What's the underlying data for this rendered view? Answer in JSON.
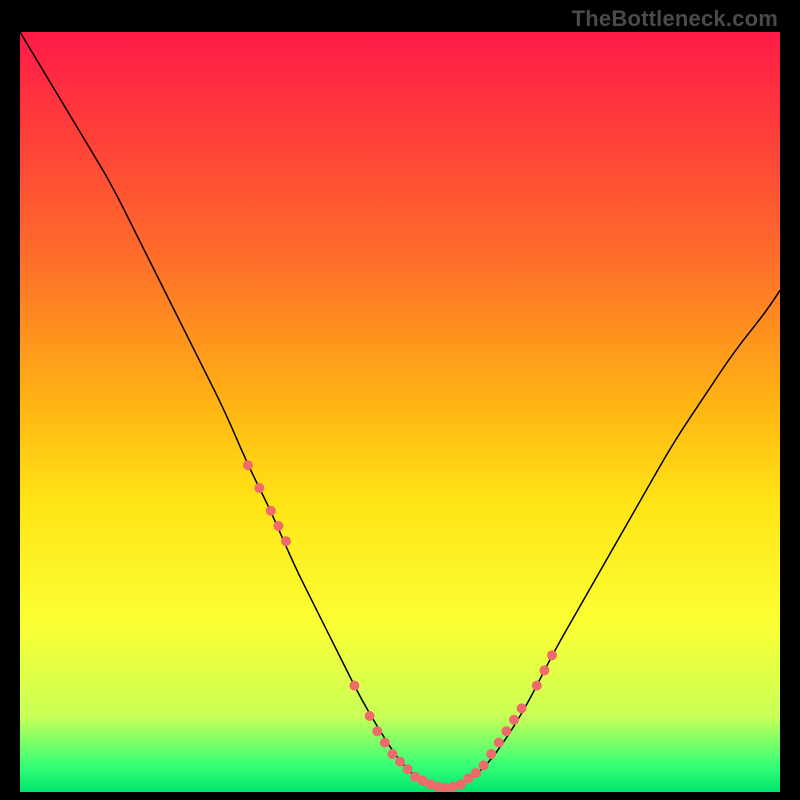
{
  "watermark": "TheBottleneck.com",
  "chart_data": {
    "type": "line",
    "title": "",
    "xlabel": "",
    "ylabel": "",
    "xlim": [
      0,
      100
    ],
    "ylim": [
      0,
      100
    ],
    "background_gradient": {
      "stops": [
        {
          "offset": 0.0,
          "color": "#ff1a48"
        },
        {
          "offset": 0.12,
          "color": "#ff3b3b"
        },
        {
          "offset": 0.3,
          "color": "#ff6e2a"
        },
        {
          "offset": 0.48,
          "color": "#ffb014"
        },
        {
          "offset": 0.62,
          "color": "#ffe515"
        },
        {
          "offset": 0.78,
          "color": "#fbff34"
        },
        {
          "offset": 0.9,
          "color": "#c9ff56"
        },
        {
          "offset": 0.965,
          "color": "#37ff76"
        },
        {
          "offset": 1.0,
          "color": "#00e56e"
        }
      ]
    },
    "series": [
      {
        "name": "curve",
        "color": "#000000",
        "x": [
          0,
          3,
          6,
          9,
          12,
          15,
          18,
          21,
          24,
          27,
          30,
          33,
          36,
          39,
          42,
          45,
          48,
          50,
          52,
          54,
          56,
          58,
          61,
          64,
          67,
          70,
          74,
          78,
          82,
          86,
          90,
          94,
          98,
          100
        ],
        "y": [
          100,
          95,
          90,
          85,
          80,
          74,
          68,
          62,
          56,
          50,
          43,
          37,
          30,
          24,
          18,
          12,
          7,
          4,
          2,
          1,
          0.5,
          1,
          3,
          7,
          12,
          18,
          25,
          32,
          39,
          46,
          52,
          58,
          63,
          66
        ]
      }
    ],
    "highlight_dots": {
      "color": "#ef6a6a",
      "radius": 5,
      "points": [
        {
          "x": 30,
          "y": 43
        },
        {
          "x": 31.5,
          "y": 40
        },
        {
          "x": 33,
          "y": 37
        },
        {
          "x": 34,
          "y": 35
        },
        {
          "x": 35,
          "y": 33
        },
        {
          "x": 44,
          "y": 14
        },
        {
          "x": 46,
          "y": 10
        },
        {
          "x": 47,
          "y": 8
        },
        {
          "x": 48,
          "y": 6.5
        },
        {
          "x": 49,
          "y": 5
        },
        {
          "x": 50,
          "y": 4
        },
        {
          "x": 51,
          "y": 3
        },
        {
          "x": 52,
          "y": 2
        },
        {
          "x": 53,
          "y": 1.5
        },
        {
          "x": 54,
          "y": 1
        },
        {
          "x": 55,
          "y": 0.7
        },
        {
          "x": 56,
          "y": 0.5
        },
        {
          "x": 57,
          "y": 0.7
        },
        {
          "x": 58,
          "y": 1
        },
        {
          "x": 59,
          "y": 1.8
        },
        {
          "x": 60,
          "y": 2.5
        },
        {
          "x": 61,
          "y": 3.5
        },
        {
          "x": 62,
          "y": 5
        },
        {
          "x": 63,
          "y": 6.5
        },
        {
          "x": 64,
          "y": 8
        },
        {
          "x": 65,
          "y": 9.5
        },
        {
          "x": 66,
          "y": 11
        },
        {
          "x": 68,
          "y": 14
        },
        {
          "x": 69,
          "y": 16
        },
        {
          "x": 70,
          "y": 18
        }
      ]
    }
  }
}
